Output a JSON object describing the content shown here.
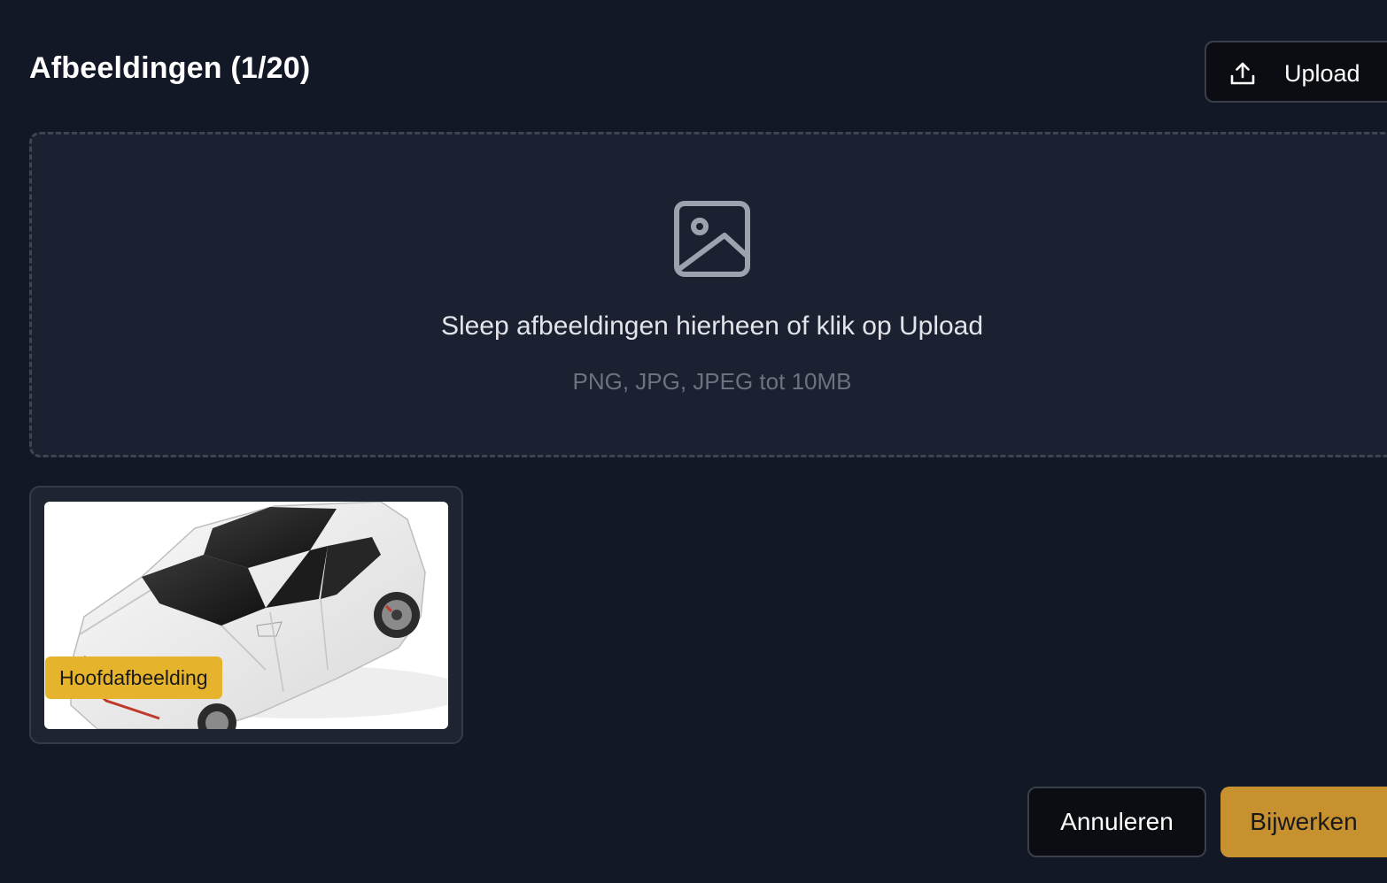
{
  "header": {
    "title": "Afbeeldingen (1/20)",
    "upload_label": "Upload",
    "upload_icon": "upload-icon"
  },
  "dropzone": {
    "icon": "image-icon",
    "main_text": "Sleep afbeeldingen hierheen of klik op Upload",
    "sub_text": "PNG, JPG, JPEG tot 10MB"
  },
  "images": [
    {
      "badge": "Hoofdafbeelding",
      "subject": "white hatchback car"
    }
  ],
  "footer": {
    "cancel_label": "Annuleren",
    "update_label": "Bijwerken"
  },
  "colors": {
    "background": "#131827",
    "dropzone_bg": "#1b2130",
    "badge": "#e6b32c",
    "primary_button": "#c8912f",
    "dark_button": "#0b0d12"
  }
}
